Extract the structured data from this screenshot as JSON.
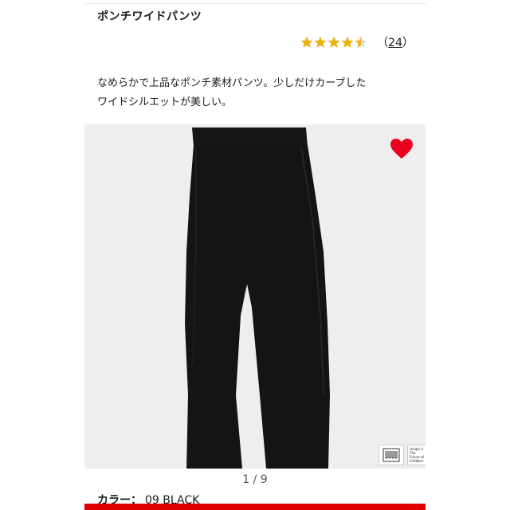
{
  "product": {
    "title": "ポンチワイドパンツ",
    "rating_value": 4.5,
    "review_count_open": "（",
    "review_count": "24",
    "review_count_close": "）",
    "description_line1": "なめらかで上品なポンチ素材パンツ。少しだけカーブした",
    "description_line2": "ワイドシルエットが美しい。"
  },
  "gallery": {
    "pager": "1 / 9",
    "badge_brand_text": "Uniqlo U",
    "badge_tagline": "The Future of LifeWear",
    "favorite_icon": "heart-icon",
    "colors": {
      "heart": "#e8001c",
      "background": "#eeeeee"
    }
  },
  "color": {
    "label": "カラー：",
    "value": "09 BLACK"
  },
  "theme": {
    "star_color": "#e9b20f",
    "accent": "#e00000"
  }
}
